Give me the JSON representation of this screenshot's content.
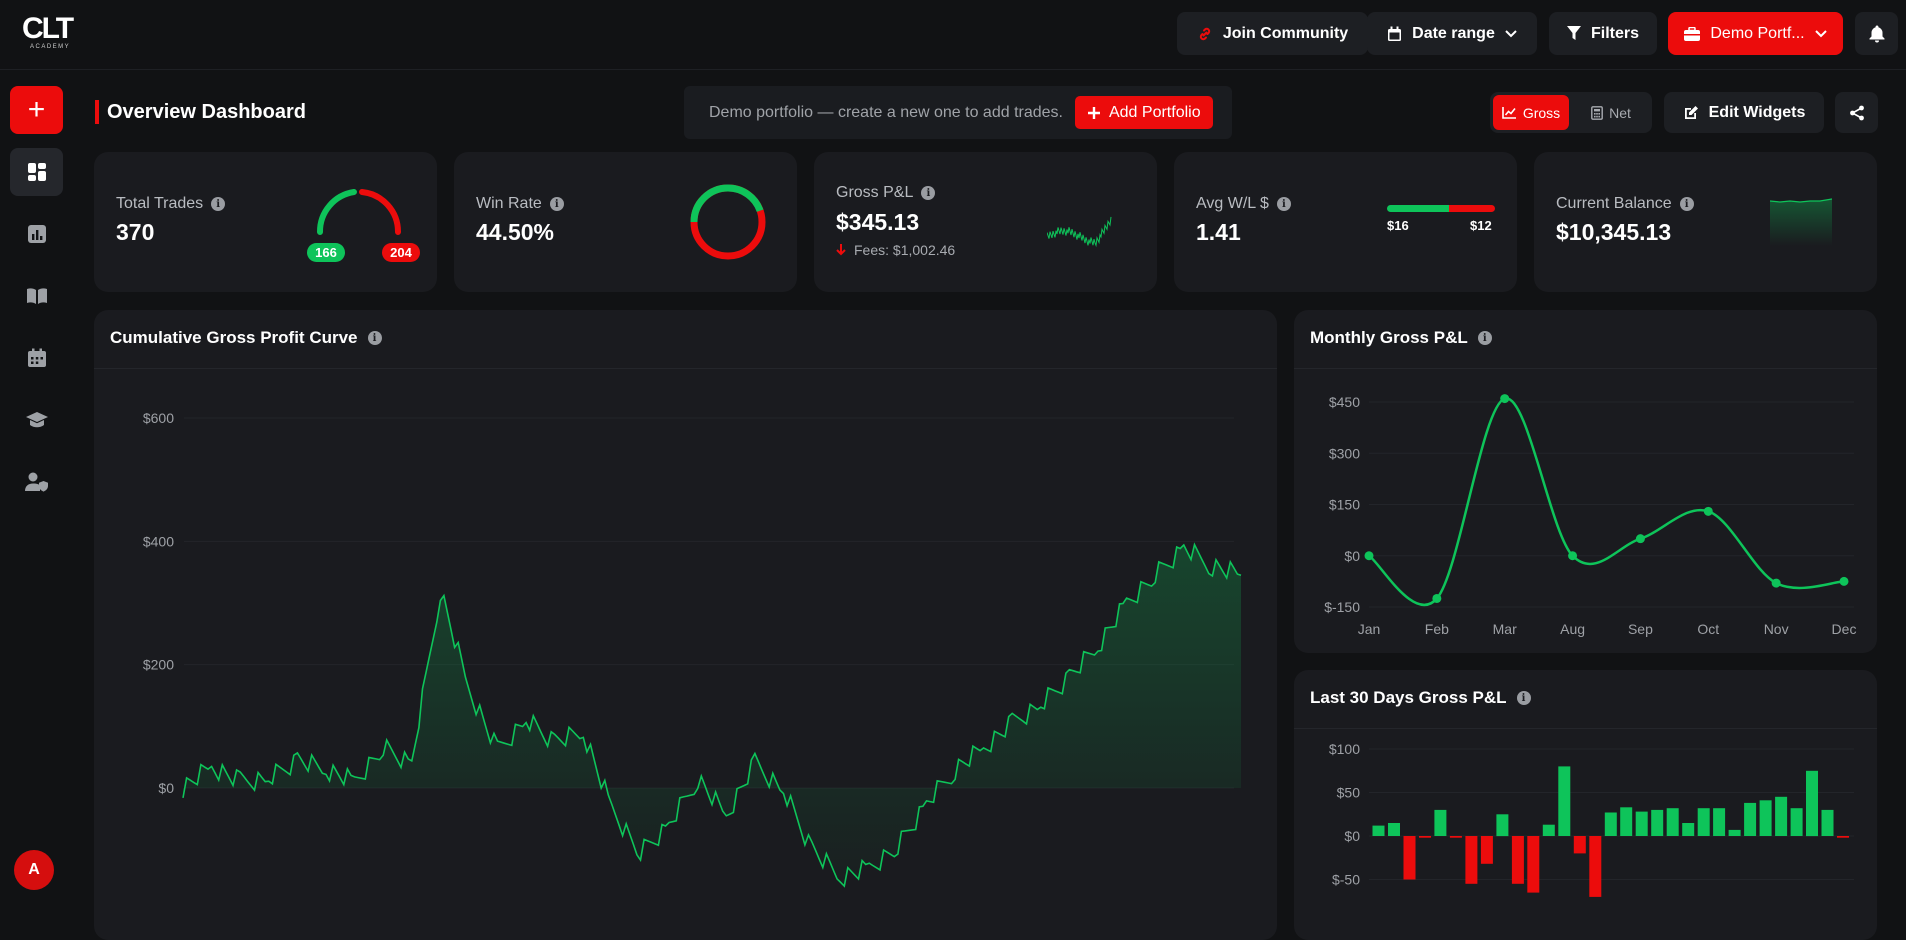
{
  "brand": {
    "logo_main": "CLT",
    "logo_sub": "ACADEMY"
  },
  "topbar": {
    "join_community": "Join Community",
    "date_range": "Date range",
    "filters": "Filters",
    "portfolio": "Demo Portf..."
  },
  "page": {
    "title": "Overview Dashboard",
    "banner_text": "Demo portfolio — create a new one to add trades.",
    "add_portfolio": "Add Portfolio",
    "toggle": {
      "gross": "Gross",
      "net": "Net",
      "selected": "Gross"
    },
    "edit_widgets": "Edit Widgets"
  },
  "sidebar": {
    "items": [
      "add-trade",
      "dashboard",
      "reports",
      "journal",
      "calendar",
      "academy",
      "profile"
    ],
    "avatar_initial": "A"
  },
  "kpis": {
    "total_trades": {
      "label": "Total Trades",
      "value": "370",
      "wins": "166",
      "losses": "204"
    },
    "win_rate": {
      "label": "Win Rate",
      "value": "44.50%",
      "fraction": 0.445
    },
    "gross_pl": {
      "label": "Gross P&L",
      "value": "$345.13",
      "fees": "Fees: $1,002.46"
    },
    "avg_wl": {
      "label": "Avg W/L $",
      "value": "1.41",
      "avg_win": "$16",
      "avg_loss": "$12"
    },
    "balance": {
      "label": "Current Balance",
      "value": "$10,345.13"
    }
  },
  "colors": {
    "accent": "#ec0c0c",
    "positive": "#0ec45a",
    "negative": "#ec0c0c",
    "card": "#1a1b1f"
  },
  "panels": {
    "cumulative": "Cumulative Gross Profit Curve",
    "monthly": "Monthly Gross P&L",
    "last30": "Last 30 Days Gross P&L"
  },
  "chart_data": [
    {
      "type": "area",
      "title": "Cumulative Gross Profit Curve",
      "y_ticks": [
        "$600",
        "$400",
        "$200",
        "$0"
      ],
      "ylim": [
        -150,
        600
      ],
      "x": [
        0,
        10,
        20,
        30,
        40,
        50,
        60,
        70,
        80,
        90,
        100,
        110,
        120,
        130,
        140,
        150,
        160,
        170,
        180,
        190,
        200,
        210,
        220,
        230,
        240,
        250,
        260,
        270,
        280,
        290,
        300,
        310,
        320,
        330,
        340,
        350,
        360,
        370
      ],
      "values": [
        0,
        35,
        10,
        15,
        45,
        30,
        10,
        65,
        40,
        320,
        160,
        60,
        110,
        75,
        90,
        -35,
        -105,
        -60,
        15,
        -45,
        40,
        -5,
        -100,
        -145,
        -130,
        -95,
        -25,
        30,
        65,
        105,
        135,
        180,
        230,
        300,
        345,
        390,
        360,
        345
      ],
      "grid": true
    },
    {
      "type": "line",
      "title": "Monthly Gross P&L",
      "categories": [
        "Jan",
        "Feb",
        "Mar",
        "Aug",
        "Sep",
        "Oct",
        "Nov",
        "Dec"
      ],
      "values": [
        0,
        -125,
        460,
        0,
        50,
        130,
        -80,
        -75
      ],
      "y_ticks": [
        "$450",
        "$300",
        "$150",
        "$0",
        "$-150"
      ],
      "ylim": [
        -150,
        450
      ],
      "grid": true
    },
    {
      "type": "bar",
      "title": "Last 30 Days Gross P&L",
      "y_ticks": [
        "$100",
        "$50",
        "$0",
        "$-50"
      ],
      "ylim": [
        -50,
        100
      ],
      "values": [
        12,
        15,
        -50,
        -2,
        30,
        -2,
        -55,
        -32,
        25,
        -55,
        -65,
        13,
        80,
        -20,
        -70,
        27,
        33,
        28,
        30,
        32,
        15,
        32,
        32,
        7,
        38,
        41,
        45,
        32,
        75,
        30,
        -2
      ],
      "grid": true
    }
  ]
}
